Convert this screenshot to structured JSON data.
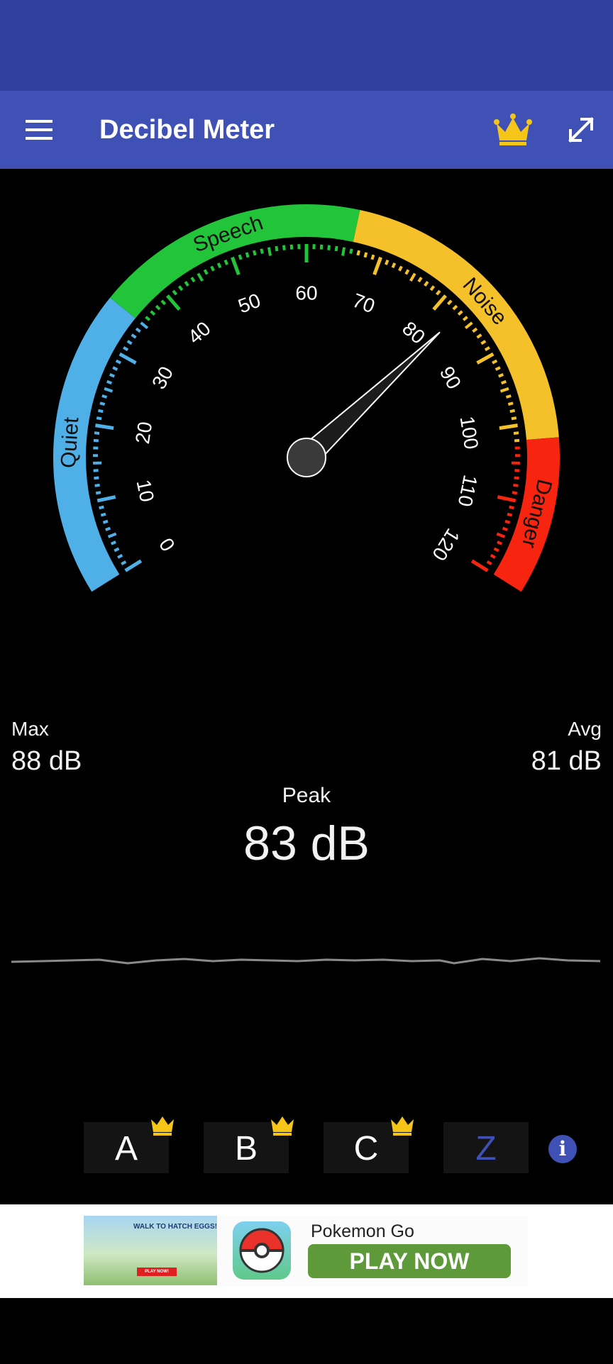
{
  "app_bar": {
    "title": "Decibel Meter",
    "menu_icon": "hamburger-menu-icon",
    "premium_icon": "crown-icon",
    "fullscreen_icon": "expand-icon"
  },
  "gauge": {
    "min": 0,
    "max": 120,
    "needle_value": 83,
    "tick_labels": [
      "0",
      "10",
      "20",
      "30",
      "40",
      "50",
      "60",
      "70",
      "80",
      "90",
      "100",
      "110",
      "120"
    ],
    "zones": [
      {
        "name": "Quiet",
        "from": 0,
        "to": 35,
        "color": "#4fb0e8"
      },
      {
        "name": "Speech",
        "from": 35,
        "to": 66,
        "color": "#22c43a"
      },
      {
        "name": "Noise",
        "from": 66,
        "to": 102,
        "color": "#f5c12a"
      },
      {
        "name": "Danger",
        "from": 102,
        "to": 120,
        "color": "#f7250f"
      }
    ]
  },
  "stats": {
    "max_label": "Max",
    "max_value": "88 dB",
    "avg_label": "Avg",
    "avg_value": "81 dB",
    "peak_label": "Peak",
    "peak_value": "83 dB"
  },
  "weighting": {
    "buttons": [
      {
        "label": "A",
        "premium": true,
        "selected": false
      },
      {
        "label": "B",
        "premium": true,
        "selected": false
      },
      {
        "label": "C",
        "premium": true,
        "selected": false
      },
      {
        "label": "Z",
        "premium": false,
        "selected": true
      }
    ],
    "info_label": "i"
  },
  "ad": {
    "image_caption": "WALK TO HATCH EGGS!",
    "image_cta": "PLAY NOW!",
    "app_name": "Pokemon Go",
    "cta": "PLAY NOW"
  },
  "colors": {
    "status_bar": "#303f9f",
    "app_bar": "#3f51b5",
    "crown": "#f5c518",
    "ad_button": "#5e9a3a"
  }
}
